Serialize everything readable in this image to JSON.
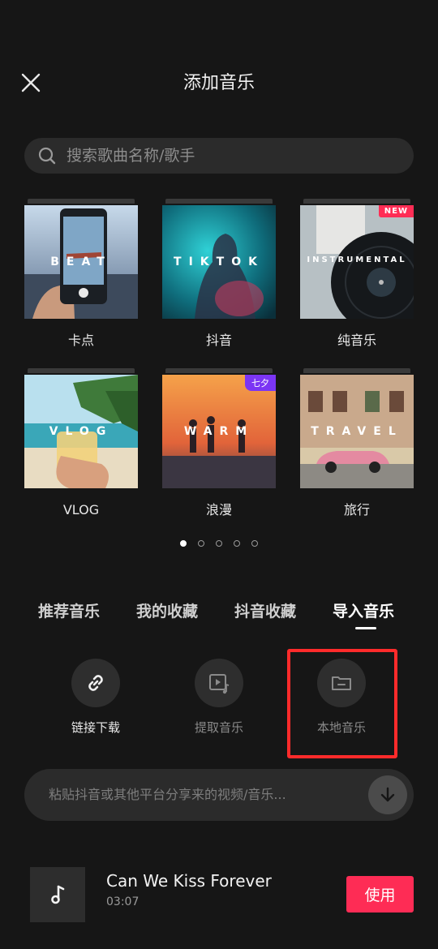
{
  "header": {
    "title": "添加音乐"
  },
  "search": {
    "placeholder": "搜索歌曲名称/歌手"
  },
  "categories": [
    {
      "label": "卡点",
      "overlay": "BEAT"
    },
    {
      "label": "抖音",
      "overlay": "TIKTOK"
    },
    {
      "label": "纯音乐",
      "overlay": "INSTRUMENTAL",
      "badge": "NEW"
    },
    {
      "label": "VLOG",
      "overlay": "VLOG"
    },
    {
      "label": "浪漫",
      "overlay": "WARM",
      "badge": "七夕"
    },
    {
      "label": "旅行",
      "overlay": "TRAVEL"
    }
  ],
  "pager": {
    "count": 5,
    "active": 1
  },
  "tabs": [
    {
      "label": "推荐音乐"
    },
    {
      "label": "我的收藏"
    },
    {
      "label": "抖音收藏"
    },
    {
      "label": "导入音乐",
      "active": true
    }
  ],
  "import_options": [
    {
      "label": "链接下载",
      "icon": "link-icon"
    },
    {
      "label": "提取音乐",
      "icon": "video-music-icon"
    },
    {
      "label": "本地音乐",
      "icon": "folder-icon"
    }
  ],
  "paste_bar": {
    "placeholder": "粘贴抖音或其他平台分享来的视频/音乐..."
  },
  "song": {
    "title": "Can We Kiss Forever",
    "duration": "03:07",
    "use_label": "使用"
  },
  "colors": {
    "background": "#161616",
    "accent": "#fe2c55",
    "highlight": "#ff2b2b"
  }
}
